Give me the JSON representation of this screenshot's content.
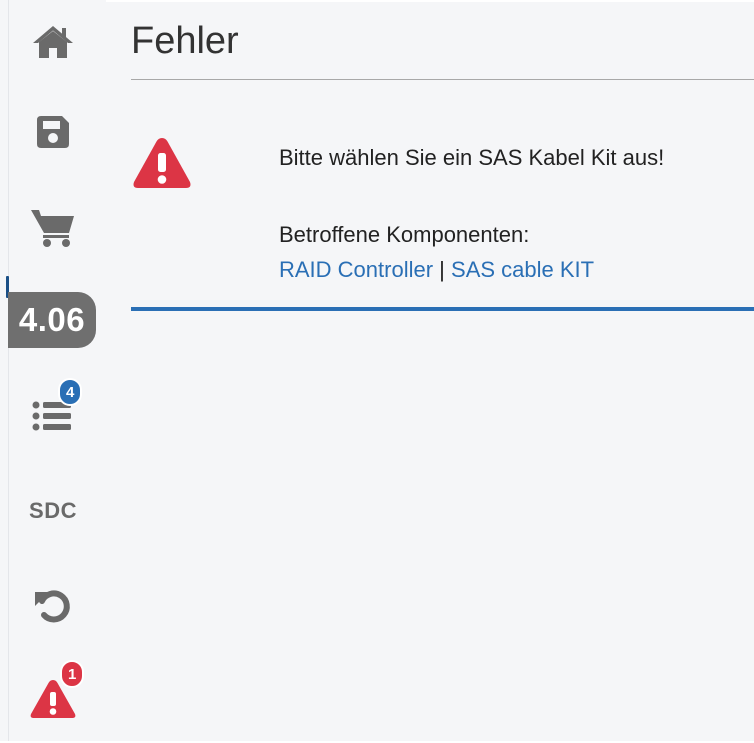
{
  "sidebar": {
    "version": "4.06",
    "list_badge": "4",
    "sdc_label": "SDC",
    "alert_badge": "1",
    "icons": [
      "home-icon",
      "save-icon",
      "cart-icon",
      "list-icon",
      "undo-icon",
      "alert-icon"
    ]
  },
  "main": {
    "title": "Fehler",
    "message": "Bitte wählen Sie ein SAS Kabel Kit aus!",
    "affected_label": "Betroffene Komponenten:",
    "links": [
      "RAID Controller",
      "SAS cable KIT"
    ],
    "separator": "|"
  },
  "colors": {
    "accent_blue": "#2a6fb5",
    "error_red": "#dc3545",
    "icon_gray": "#6a6a6a",
    "version_pill": "#6f6f6f"
  }
}
